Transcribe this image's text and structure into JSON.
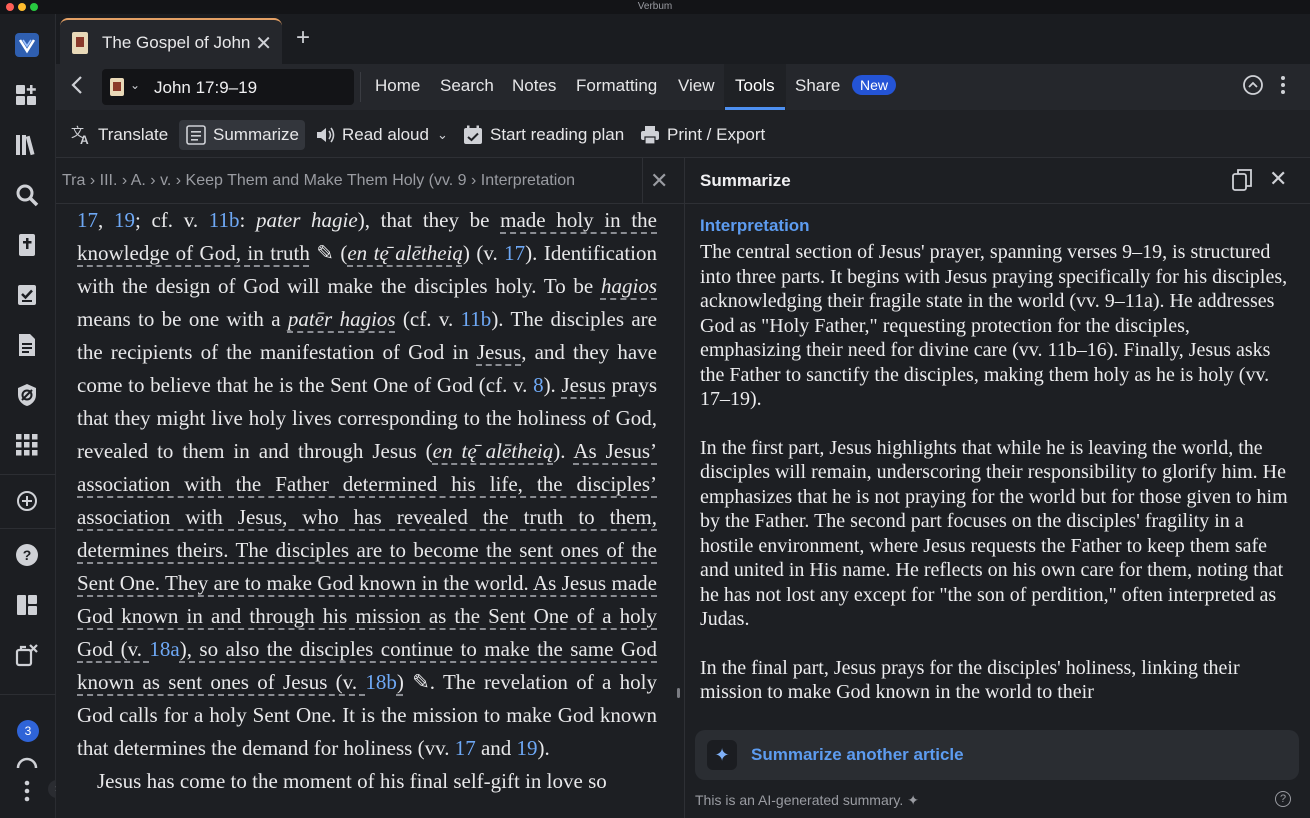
{
  "app": {
    "title": "Verbum"
  },
  "tab": {
    "label": "The Gospel of John",
    "close": "✕",
    "new_tab": "+"
  },
  "nav": {
    "reference": "John 17:9–19",
    "menu": [
      "Home",
      "Search",
      "Notes",
      "Formatting",
      "View",
      "Tools",
      "Share"
    ],
    "new_badge": "New"
  },
  "toolbar": {
    "translate": "Translate",
    "summarize": "Summarize",
    "read_aloud": "Read aloud",
    "reading_plan": "Start reading plan",
    "print_export": "Print / Export"
  },
  "breadcrumb": {
    "text": "Tra › III. › A. › v. › Keep Them and Make Them Holy (vv. 9 › Interpretation"
  },
  "reader": {
    "p1_a": "17",
    "p1_b": ", ",
    "p1_c": "19",
    "p1_d": "; cf. v. ",
    "p1_e": "11b",
    "p1_f": ": ",
    "p1_g": "pater hagie",
    "p1_h": "), that they be ",
    "p1_i": "made holy in the knowledge of God, in truth",
    "p1_j": " ✎ (",
    "p1_k": "en tę̄ alētheią",
    "p1_l": ") (v. ",
    "p1_m": "17",
    "p1_n": "). Identification with the design of God will make the disciples holy. To be ",
    "p1_o": "hagios",
    "p1_p": " means to be one with a ",
    "p1_q": "patēr hagios",
    "p1_r": " (cf. v. ",
    "p1_s": "11b",
    "p1_t": "). The disciples are the recipients of the manifestation of God in ",
    "p1_u": "Jesus",
    "p1_v": ", and they have come to believe that he is the Sent One of God (cf. v. ",
    "p1_w": "8",
    "p1_x": "). ",
    "p1_y": "Jesus",
    "p1_z": " prays that they might live holy lives corresponding to the holiness of God, revealed to them in and through Jesus (",
    "p1_aa": "en tę̄ alētheią",
    "p1_ab": "). ",
    "p1_ac": "As Jesus’ association with the Father determined his life, the disciples’ association with Jesus, who has revealed the truth to them, determines theirs. The disciples are to become the sent ones of the Sent One. They are to make God known in the world. As Jesus made God known in and through his mission as the Sent One of a holy God (v. ",
    "p1_ad": "18a",
    "p1_ae": "), so also the disciples continue to make the same God known as sent ones of Jesus (v. ",
    "p1_af": "18b",
    "p1_ag": ")",
    "p1_ah": " ✎. The revelation of a holy God calls for a holy Sent One. It is the mission to make God known that determines the demand for holiness (vv. ",
    "p1_ai": "17",
    "p1_aj": " and ",
    "p1_ak": "19",
    "p1_al": ").",
    "p2": "Jesus has come to the moment of his final self-gift in love so"
  },
  "summary": {
    "title": "Summarize",
    "heading": "Interpretation",
    "paragraphs": [
      "The central section of Jesus' prayer, spanning verses 9–19, is structured into three parts. It begins with Jesus praying specifically for his disciples, acknowledging their fragile state in the world (vv. 9–11a). He addresses God as \"Holy Father,\" requesting protection for the disciples, emphasizing their need for divine care (vv. 11b–16). Finally, Jesus asks the Father to sanctify the disciples, making them holy as he is holy (vv. 17–19).",
      "In the first part, Jesus highlights that while he is leaving the world, the disciples will remain, underscoring their responsibility to glorify him. He emphasizes that he is not praying for the world but for those given to him by the Father. The second part focuses on the disciples' fragility in a hostile environment, where Jesus requests the Father to keep them safe and united in His name. He reflects on his own care for them, noting that he has not lost any except for \"the son of perdition,\" often interpreted as Judas.",
      "In the final part, Jesus prays for the disciples' holiness, linking their mission to make God known in the world to their"
    ],
    "another": "Summarize another article",
    "footnote": "This is an AI-generated summary.",
    "help": "?"
  },
  "rail": {
    "badge": "3"
  },
  "colors": {
    "accent": "#4d8ff0",
    "link": "#6ea8f5",
    "badge": "#2454d6",
    "tab_accent": "#e4a065"
  }
}
